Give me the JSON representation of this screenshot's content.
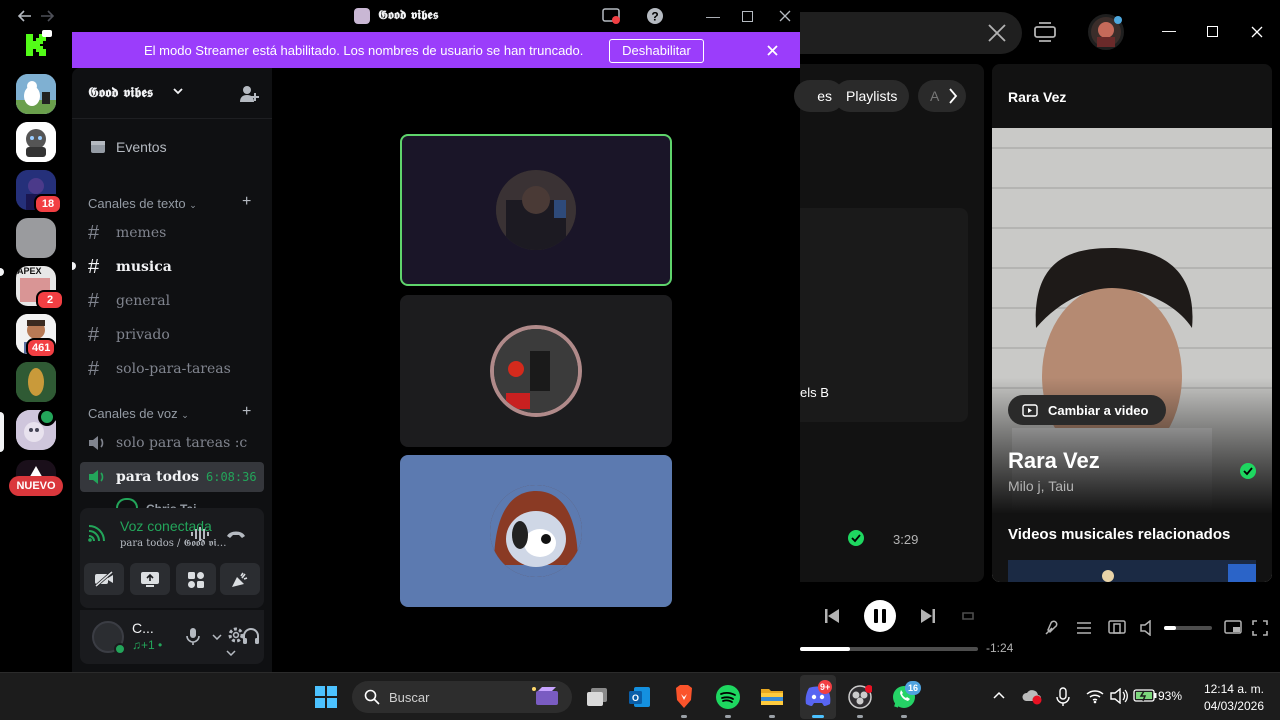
{
  "discord": {
    "window_title": "𝕲𝖔𝖔𝖉 𝖛𝖎𝖇𝖊𝖘",
    "streamer_banner": {
      "text": "El modo Streamer está habilitado. Los nombres de usuario se han truncado.",
      "button": "Deshabilitar"
    },
    "rail": {
      "badges": [
        "18",
        "2",
        "461"
      ],
      "new_label": "NUEVO",
      "apex_text": "APEX"
    },
    "server_name": "𝕲𝖔𝖔𝖉 𝖛𝖎𝖇𝖊𝖘",
    "events_label": "Eventos",
    "text_category": "Canales de texto",
    "text_channels": [
      "memes",
      "musica",
      "general",
      "privado",
      "solo-para-tareas"
    ],
    "voice_category": "Canales de voz",
    "voice_channels": [
      {
        "name": "solo para tareas :c"
      },
      {
        "name": "para todos",
        "timer": "6:08:36"
      }
    ],
    "voice_user_partial": "Chris Tai…",
    "voice_status": {
      "title": "Voz conectada",
      "subtitle": "para todos / 𝕲𝖔𝖔𝖉 𝖛𝖎…"
    },
    "user": {
      "name": "C...",
      "status": "♫+1 •"
    }
  },
  "spotify": {
    "chips": [
      "es",
      "Playlists",
      "A"
    ],
    "partial_row_text": "els B",
    "track_duration": "3:29",
    "now_playing": {
      "header": "Rara Vez",
      "cambiar_video": "Cambiar a video",
      "title": "Rara Vez",
      "artists": "Milo j, Taiu",
      "related": "Videos musicales relacionados"
    },
    "remaining_time": "-1:24",
    "progress_fraction": 0.28,
    "volume_fraction": 0.25
  },
  "taskbar": {
    "search_placeholder": "Buscar",
    "discord_badge": "9+",
    "whatsapp_badge": "16",
    "battery": "93%",
    "time": "12:14 a. m.",
    "date": "04/03/2026"
  },
  "colors": {
    "streamer_purple": "#9b3dfb",
    "discord_green": "#23a55a",
    "spotify_green": "#1ed760",
    "badge_red": "#f23f43"
  }
}
